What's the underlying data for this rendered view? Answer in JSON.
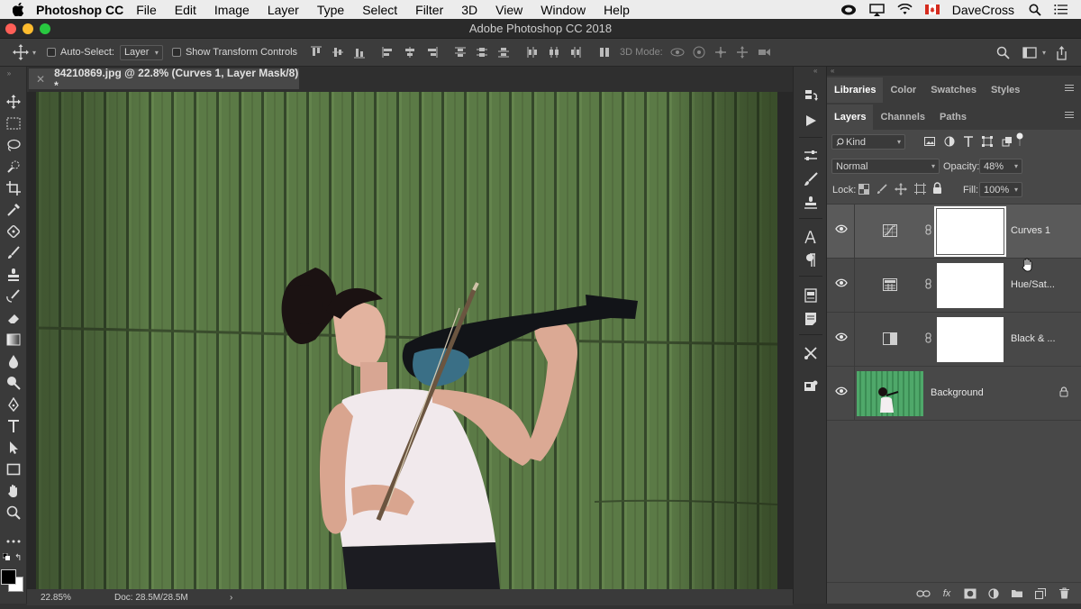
{
  "menubar": {
    "app_name": "Photoshop CC",
    "items": [
      "File",
      "Edit",
      "Image",
      "Layer",
      "Type",
      "Select",
      "Filter",
      "3D",
      "View",
      "Window",
      "Help"
    ],
    "user": "DaveCross"
  },
  "window": {
    "title": "Adobe Photoshop CC 2018"
  },
  "options": {
    "auto_select_label": "Auto-Select:",
    "auto_select_value": "Layer",
    "transform_label": "Show Transform Controls",
    "mode_3d_label": "3D Mode:"
  },
  "document": {
    "tab_title": "84210869.jpg @ 22.8% (Curves 1, Layer Mask/8) *"
  },
  "status": {
    "zoom": "22.85%",
    "doc_size": "Doc: 28.5M/28.5M"
  },
  "panels": {
    "top_tabs": [
      "Libraries",
      "Color",
      "Swatches",
      "Styles"
    ],
    "layer_tabs": [
      "Layers",
      "Channels",
      "Paths"
    ],
    "filter_kind": "Kind",
    "blend_mode": "Normal",
    "opacity_label": "Opacity:",
    "opacity_value": "48%",
    "lock_label": "Lock:",
    "fill_label": "Fill:",
    "fill_value": "100%",
    "fx_label": "fx",
    "layers": [
      {
        "name": "Curves 1",
        "icon": "curves-adjustment-icon",
        "selected": true
      },
      {
        "name": "Hue/Sat...",
        "icon": "hue-saturation-adjustment-icon",
        "selected": false
      },
      {
        "name": "Black & ...",
        "icon": "black-white-adjustment-icon",
        "selected": false
      },
      {
        "name": "Background",
        "icon": "image-thumbnail",
        "selected": false,
        "locked": true
      }
    ]
  },
  "colors": {
    "accent_red": "#ff5f57",
    "accent_yellow": "#febc2e",
    "accent_green": "#28c840",
    "panel_bg": "#484848",
    "wall_green": "#5a7a45"
  }
}
